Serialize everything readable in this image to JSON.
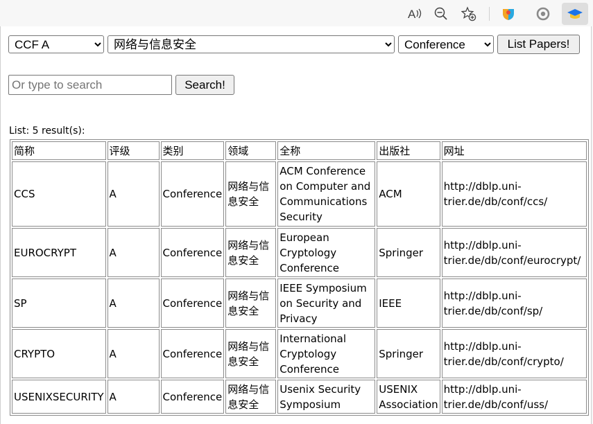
{
  "browser": {
    "icons": [
      "read-aloud-icon",
      "zoom-out-icon",
      "favorites-add-icon",
      "extension-shield-icon",
      "extension-circle-icon",
      "extension-graduation-cap-icon"
    ]
  },
  "filters": {
    "rank_selected": "CCF A",
    "field_selected": "网络与信息安全",
    "type_selected": "Conference",
    "list_button": "List Papers!"
  },
  "search": {
    "placeholder": "Or type to search",
    "value": "",
    "button": "Search!"
  },
  "results": {
    "count_text": "List: 5 result(s):",
    "headers": [
      "简称",
      "评级",
      "类别",
      "领域",
      "全称",
      "出版社",
      "网址"
    ],
    "rows": [
      [
        "CCS",
        "A",
        "Conference",
        "网络与信息安全",
        "ACM Conference on Computer and Communications Security",
        "ACM",
        "http://dblp.uni-trier.de/db/conf/ccs/"
      ],
      [
        "EUROCRYPT",
        "A",
        "Conference",
        "网络与信息安全",
        "European Cryptology Conference",
        "Springer",
        "http://dblp.uni-trier.de/db/conf/eurocrypt/"
      ],
      [
        "SP",
        "A",
        "Conference",
        "网络与信息安全",
        "IEEE Symposium on Security and Privacy",
        "IEEE",
        "http://dblp.uni-trier.de/db/conf/sp/"
      ],
      [
        "CRYPTO",
        "A",
        "Conference",
        "网络与信息安全",
        "International Cryptology Conference",
        "Springer",
        "http://dblp.uni-trier.de/db/conf/crypto/"
      ],
      [
        "USENIXSECURITY",
        "A",
        "Conference",
        "网络与信息安全",
        "Usenix Security Symposium",
        "USENIX Association",
        "http://dblp.uni-trier.de/db/conf/uss/"
      ]
    ]
  },
  "colors": {
    "toolbar_bg": "#f7f7f7",
    "panel_bg": "#ffffff",
    "border": "#8a8a8a",
    "extension_active": "#1a73e8"
  }
}
